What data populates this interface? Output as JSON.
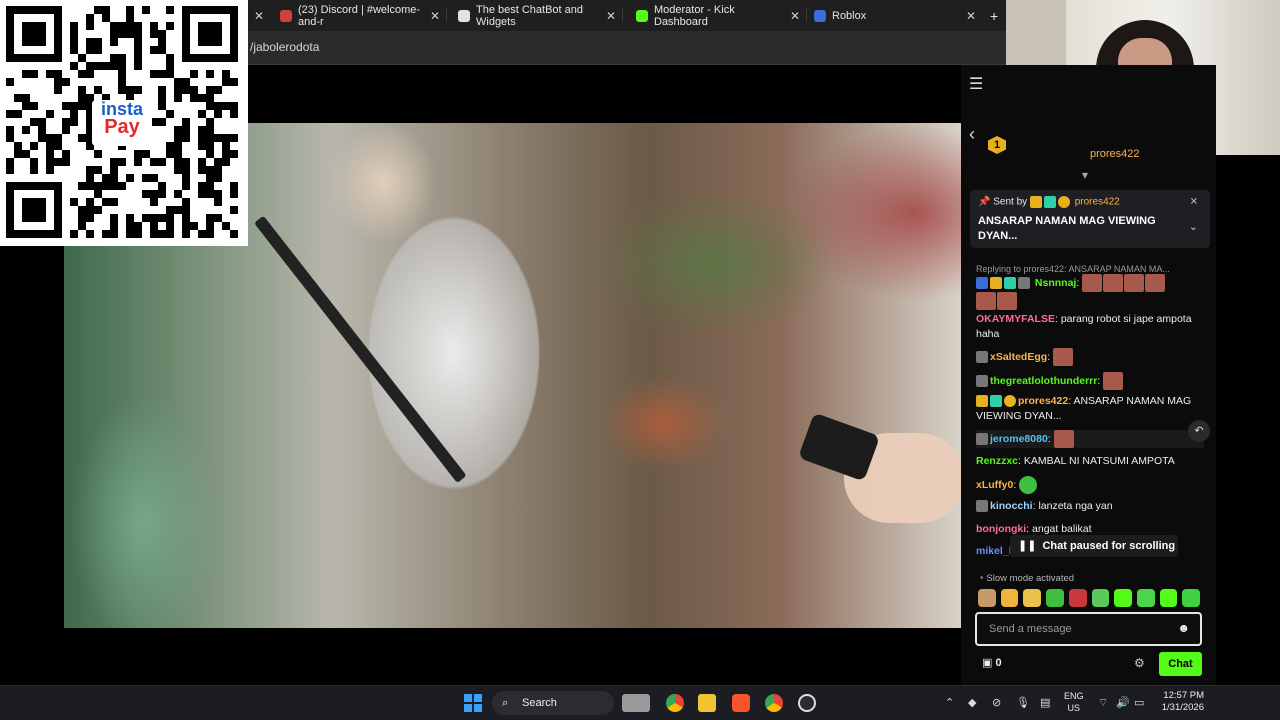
{
  "browser": {
    "tabs": [
      {
        "label": "(23) Discord | #welcome-and-r",
        "color": "#d04040"
      },
      {
        "label": "The best ChatBot and Widgets",
        "color": "#e2e2e2"
      },
      {
        "label": "Moderator - Kick Dashboard",
        "color": "#53fc18"
      },
      {
        "label": "Roblox",
        "color": "#3a6fd8"
      }
    ],
    "url": "/jabolerodota"
  },
  "qr": {
    "logo_top": "insta",
    "logo_bottom": "Pay"
  },
  "chat": {
    "top_badge_count": "1",
    "top_gifter": "prores422",
    "pinned": {
      "sent_by_label": "Sent by",
      "sender": "prores422",
      "message": "ANSARAP NAMAN MAG VIEWING DYAN..."
    },
    "messages": [
      {
        "type": "reply",
        "text": "Replying to prores422: ANSARAP NAMAN MA..."
      },
      {
        "user": "Nsnnnaj",
        "color": "#53fc18",
        "text": ""
      },
      {
        "user": "OKAYMYFALSE",
        "color": "#ff6b9a",
        "text": "parang robot si jape ampota haha"
      },
      {
        "user": "xSaltedEgg",
        "color": "#ffb14d",
        "text": ""
      },
      {
        "user": "thegreatlolothunderrr",
        "color": "#53fc18",
        "text": ""
      },
      {
        "user": "prores422",
        "color": "#ffb14d",
        "text": "ANSARAP NAMAN MAG VIEWING DYAN..."
      },
      {
        "user": "jerome8080",
        "color": "#4fc3f7",
        "text": ""
      },
      {
        "user": "Renzzxc",
        "color": "#53fc18",
        "text": "KAMBAL NI NATSUMI AMPOTA"
      },
      {
        "user": "xLuffy0",
        "color": "#ffb14d",
        "text": ""
      },
      {
        "user": "kinocchi",
        "color": "#9fd4ff",
        "text": "lanzeta nga yan"
      },
      {
        "user": "bonjongki",
        "color": "#ff6b9a",
        "text": "angat balikat"
      },
      {
        "user": "mikel_l",
        "color": "#6a8dff",
        "text": ""
      }
    ],
    "paused_text": "Chat paused for scrolling",
    "slow_mode": "Slow mode activated",
    "input_placeholder": "Send a message",
    "points": "0",
    "send_label": "Chat"
  },
  "taskbar": {
    "search_label": "Search",
    "lang_top": "ENG",
    "lang_bottom": "US",
    "time": "12:57 PM",
    "date": "1/31/2026"
  }
}
